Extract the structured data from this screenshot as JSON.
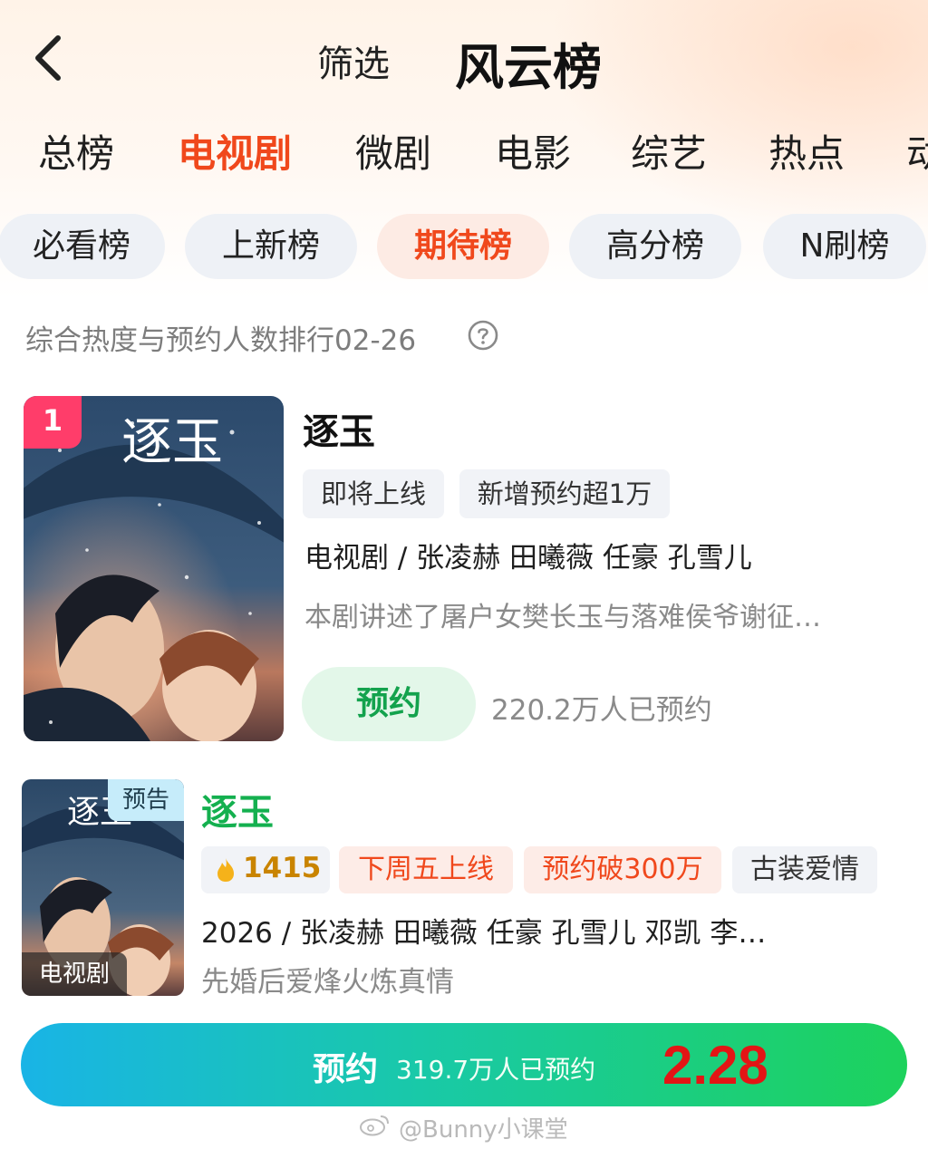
{
  "header": {
    "filter_label": "筛选",
    "title": "风云榜"
  },
  "category_tabs": [
    "总榜",
    "电视剧",
    "微剧",
    "电影",
    "综艺",
    "热点",
    "动"
  ],
  "active_category": "电视剧",
  "rank_pills": [
    "必看榜",
    "上新榜",
    "期待榜",
    "高分榜",
    "N刷榜"
  ],
  "active_pill": "期待榜",
  "rank_description": "综合热度与预约人数排行02-26",
  "item1": {
    "rank": "1",
    "title": "逐玉",
    "tags": [
      "即将上线",
      "新增预约超1万"
    ],
    "meta": "电视剧 / 张凌赫 田曦薇 任豪 孔雪儿",
    "description": "本剧讲述了屠户女樊长玉与落难侯爷谢征…",
    "reserve_label": "预约",
    "reserve_count": "220.2万人已预约",
    "poster_title": "逐玉"
  },
  "item2": {
    "badge_trailer": "预告",
    "badge_type": "电视剧",
    "title": "逐玉",
    "heat": "1415",
    "tags": [
      "下周五上线",
      "预约破300万",
      "古装爱情"
    ],
    "meta": "2026 / 张凌赫  田曦薇  任豪  孔雪儿  邓凯  李…",
    "description": "先婚后爱烽火炼真情",
    "poster_title": "逐玉"
  },
  "reserve_bar": {
    "label": "预约",
    "count": "319.7万人已预约",
    "date": "2.28"
  },
  "watermark": "@Bunny小课堂",
  "colors": {
    "accent": "#f0481c",
    "green": "#13a24d",
    "title_green": "#14b04f",
    "date_red": "#e31515"
  }
}
